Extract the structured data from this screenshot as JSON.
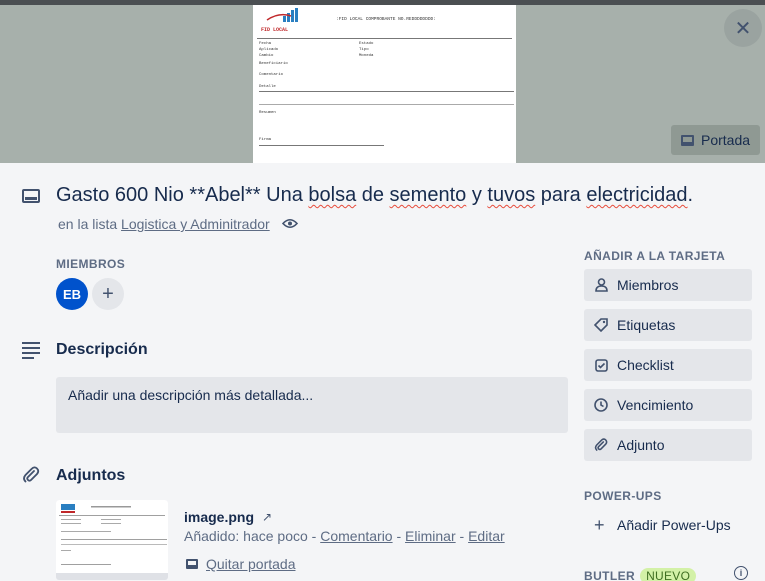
{
  "cover": {
    "doc_header": ":FID LOCAL COMPROBANTE NO.REDDDDDDDD:",
    "doc_brand": "FID LOCAL",
    "doc_fields_left": [
      "Fecha",
      "Aplicado",
      "Cambio"
    ],
    "doc_fields_right": [
      "Estado",
      "Tipo",
      "Moneda"
    ],
    "doc_beneficiario": "Beneficiario",
    "doc_comentario": "Comentario",
    "doc_detalle": "Detalle",
    "doc_resumen": "Resumen",
    "doc_firma": "Firma",
    "portada_label": "Portada"
  },
  "card": {
    "title_parts": [
      {
        "text": "Gasto 600 Nio **Abel** Una ",
        "squiggle": false
      },
      {
        "text": "bolsa",
        "squiggle": true
      },
      {
        "text": " de ",
        "squiggle": false
      },
      {
        "text": "semento",
        "squiggle": true
      },
      {
        "text": " y ",
        "squiggle": false
      },
      {
        "text": "tuvos",
        "squiggle": true
      },
      {
        "text": " para ",
        "squiggle": false
      },
      {
        "text": "electricidad",
        "squiggle": true
      },
      {
        "text": ".",
        "squiggle": false
      }
    ],
    "in_list_prefix": "en la lista ",
    "list_name": "Logistica y Adminitrador"
  },
  "members": {
    "label": "MIEMBROS",
    "avatar_initials": "EB",
    "add_symbol": "+"
  },
  "description": {
    "title": "Descripción",
    "placeholder": "Añadir una descripción más detallada..."
  },
  "attachments": {
    "title": "Adjuntos",
    "file_name": "image.png",
    "ext_arrow": "↗",
    "added": "Añadido: hace poco",
    "sep": " - ",
    "comment": "Comentario",
    "delete": "Eliminar",
    "edit": "Editar",
    "remove_cover": "Quitar portada"
  },
  "sidebar": {
    "add_to_card_label": "AÑADIR A LA TARJETA",
    "buttons": [
      {
        "label": "Miembros",
        "icon": "user-icon"
      },
      {
        "label": "Etiquetas",
        "icon": "tag-icon"
      },
      {
        "label": "Checklist",
        "icon": "checklist-icon"
      },
      {
        "label": "Vencimiento",
        "icon": "clock-icon"
      },
      {
        "label": "Adjunto",
        "icon": "paperclip-icon"
      }
    ],
    "powerups_label": "POWER-UPS",
    "add_powerups": "Añadir Power-Ups",
    "butler_label": "BUTLER",
    "nuevo_badge": "NUEVO"
  }
}
